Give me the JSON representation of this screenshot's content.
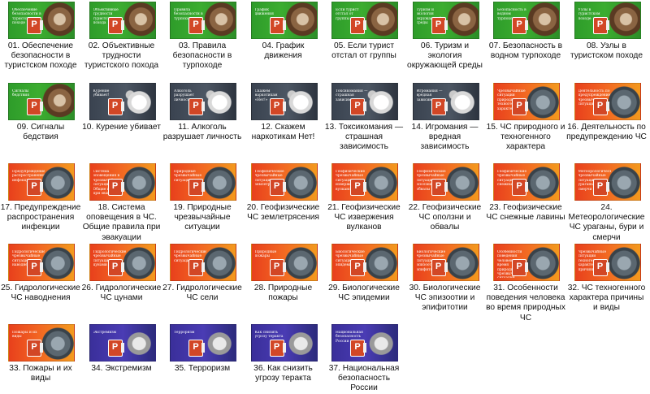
{
  "files": [
    {
      "name": "01. Обеспечение безопасности в туристском походе",
      "caption": "Обеспечение безопасности в туристском походе",
      "theme": "green"
    },
    {
      "name": "02. Объективные трудности туристского похода",
      "caption": "Объективные трудности туристского похода",
      "theme": "green"
    },
    {
      "name": "03. Правила безопасности в турпоходе",
      "caption": "Правила безопасности в турпоходе",
      "theme": "green"
    },
    {
      "name": "04. График движения",
      "caption": "График движения",
      "theme": "green"
    },
    {
      "name": "05. Если турист отстал от группы",
      "caption": "Если турист отстал от группы",
      "theme": "green"
    },
    {
      "name": "06. Туризм и экология окружающей среды",
      "caption": "Туризм и экология окружающей среды",
      "theme": "green"
    },
    {
      "name": "07. Безопасность в водном турпоходе",
      "caption": "Безопасность в водном турпоходе",
      "theme": "green"
    },
    {
      "name": "08. Узлы в туристском походе",
      "caption": "Узлы в туристском походе",
      "theme": "green"
    },
    {
      "name": "09. Сигналы бедствия",
      "caption": "Сигналы бедствия",
      "theme": "green"
    },
    {
      "name": "10. Курение убивает",
      "caption": "Курение убивает!",
      "theme": "dark"
    },
    {
      "name": "11. Алкоголь разрушает личность",
      "caption": "Алкоголь разрушает личность",
      "theme": "dark"
    },
    {
      "name": "12. Скажем наркотикам Нет!",
      "caption": "Скажем наркотикам «Нет!»",
      "theme": "dark"
    },
    {
      "name": "13. Токсикомания — страшная зависимость",
      "caption": "Токсикомания — страшная зависимость",
      "theme": "dark"
    },
    {
      "name": "14. Игромания — вредная зависимость",
      "caption": "Игромания — вредная зависимость",
      "theme": "dark"
    },
    {
      "name": "15. ЧС природного и техногенного характера",
      "caption": "Чрезвычайные ситуации природного и техногенного характера",
      "theme": "orange"
    },
    {
      "name": "16. Деятельность по предупреждению ЧС",
      "caption": "Деятельность по предупреждению чрезвычайных ситуаций",
      "theme": "orange"
    },
    {
      "name": "17. Предупреждение распространения инфекции",
      "caption": "Предупреждение распространения инфекции",
      "theme": "orange"
    },
    {
      "name": "18. Система оповещения в ЧС. Общие правила при эвакуации",
      "caption": "Система оповещения в чрезвычайных ситуациях. Общие правила при эвакуации",
      "theme": "orange"
    },
    {
      "name": "19. Природные чрезвычайные ситуации",
      "caption": "Природные чрезвычайные ситуации",
      "theme": "orange"
    },
    {
      "name": "20. Геофизические ЧС землетрясения",
      "caption": "Геофизические чрезвычайные ситуации: землетрясения",
      "theme": "orange"
    },
    {
      "name": "21. Геофизические ЧС извержения вулканов",
      "caption": "Геофизические чрезвычайные ситуации: извержения вулканов",
      "theme": "orange"
    },
    {
      "name": "22. Геофизические ЧС оползни и обвалы",
      "caption": "Геофизические чрезвычайные ситуации: оползни и обвалы",
      "theme": "orange"
    },
    {
      "name": "23. Геофизические ЧС снежные лавины",
      "caption": "Геофизические чрезвычайные ситуации: снежные лавины",
      "theme": "orange"
    },
    {
      "name": "24. Метеорологические ЧС ураганы, бури и смерчи",
      "caption": "Метеорологические чрезвычайные ситуации: ураганы, бури и смерчи",
      "theme": "orange"
    },
    {
      "name": "25. Гидрологические ЧС наводнения",
      "caption": "Гидрологические чрезвычайные ситуации: наводнения",
      "theme": "orange"
    },
    {
      "name": "26. Гидрологические ЧС цунами",
      "caption": "Гидрологические чрезвычайные ситуации: цунами",
      "theme": "orange"
    },
    {
      "name": "27. Гидрологические ЧС сели",
      "caption": "Гидрологические чрезвычайные ситуации: сели",
      "theme": "orange"
    },
    {
      "name": "28. Природные пожары",
      "caption": "Природные пожары",
      "theme": "orange"
    },
    {
      "name": "29. Биологические ЧС эпидемии",
      "caption": "Биологические чрезвычайные ситуации: эпидемии",
      "theme": "orange"
    },
    {
      "name": "30. Биологические ЧС эпизоотии и эпифитотии",
      "caption": "Биологические чрезвычайные ситуации: эпизоотии и эпифитотии",
      "theme": "orange"
    },
    {
      "name": "31. Особенности поведения человека во время природных ЧС",
      "caption": "Особенности поведения человека во время природных чрезвычайных ситуаций",
      "theme": "orange"
    },
    {
      "name": "32. ЧС техногенного характера причины и виды",
      "caption": "Чрезвычайные ситуации техногенного характера: причины и виды",
      "theme": "orange"
    },
    {
      "name": "33. Пожары и их виды",
      "caption": "Пожары и их виды",
      "theme": "orange"
    },
    {
      "name": "34. Экстремизм",
      "caption": "Экстремизм",
      "theme": "purple"
    },
    {
      "name": "35. Терроризм",
      "caption": "Терроризм",
      "theme": "purple"
    },
    {
      "name": "36. Как снизить угрозу теракта",
      "caption": "Как снизить угрозу теракта",
      "theme": "purple"
    },
    {
      "name": "37. Национальная безопасность России",
      "caption": "Национальная безопасность России",
      "theme": "purple"
    }
  ],
  "icon": "powerpoint-file-icon"
}
